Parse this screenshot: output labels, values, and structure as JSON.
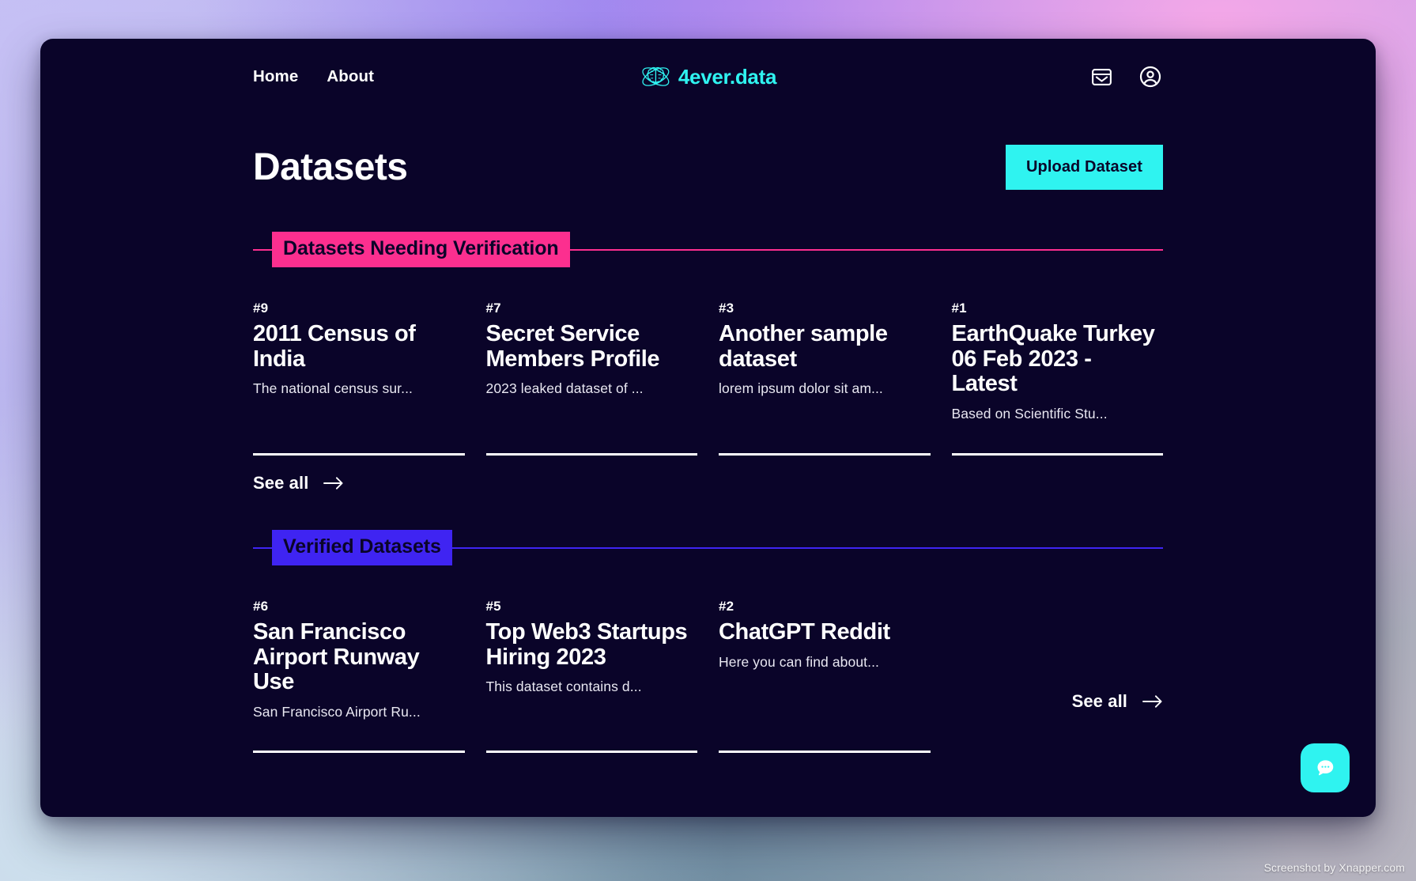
{
  "window": {
    "background_dark": "#0a0429",
    "accent_cyan": "#2ff3f0",
    "accent_pink": "#fc2f8f",
    "accent_blue": "#3f24f2"
  },
  "nav": {
    "links": [
      {
        "label": "Home",
        "name": "nav-link-home"
      },
      {
        "label": "About",
        "name": "nav-link-about"
      }
    ],
    "brand": {
      "text": "4ever.data",
      "logo_icon": "brain-atom-icon"
    },
    "icons": [
      {
        "name": "inbox-icon",
        "label": "Inbox"
      },
      {
        "name": "account-circle-icon",
        "label": "Account"
      }
    ]
  },
  "page": {
    "title": "Datasets",
    "upload_button": "Upload Dataset"
  },
  "sections": [
    {
      "id": "needing-verification",
      "badge": "Datasets Needing Verification",
      "badge_color": "#fc2f8f",
      "see_all": "See all",
      "see_all_position": "left",
      "cards": [
        {
          "rank": "#9",
          "title": "2011 Census of India",
          "description": "The national census sur..."
        },
        {
          "rank": "#7",
          "title": "Secret Service Members Profile",
          "description": "2023 leaked dataset of ..."
        },
        {
          "rank": "#3",
          "title": "Another sample dataset",
          "description": "lorem ipsum dolor sit am..."
        },
        {
          "rank": "#1",
          "title": "EarthQuake Turkey 06 Feb 2023 - Latest",
          "description": "Based on Scientific Stu..."
        }
      ]
    },
    {
      "id": "verified",
      "badge": "Verified Datasets",
      "badge_color": "#3f24f2",
      "see_all": "See all",
      "see_all_position": "right",
      "cards": [
        {
          "rank": "#6",
          "title": "San Francisco Airport Runway Use",
          "description": "San Francisco Airport Ru..."
        },
        {
          "rank": "#5",
          "title": "Top Web3 Startups Hiring 2023",
          "description": "This dataset contains d..."
        },
        {
          "rank": "#2",
          "title": "ChatGPT Reddit",
          "description": "Here you can find about..."
        }
      ]
    }
  ],
  "chat": {
    "icon": "chat-bubble-icon",
    "label": "Open chat"
  },
  "watermark": {
    "text": "Screenshot by Xnapper.com"
  }
}
